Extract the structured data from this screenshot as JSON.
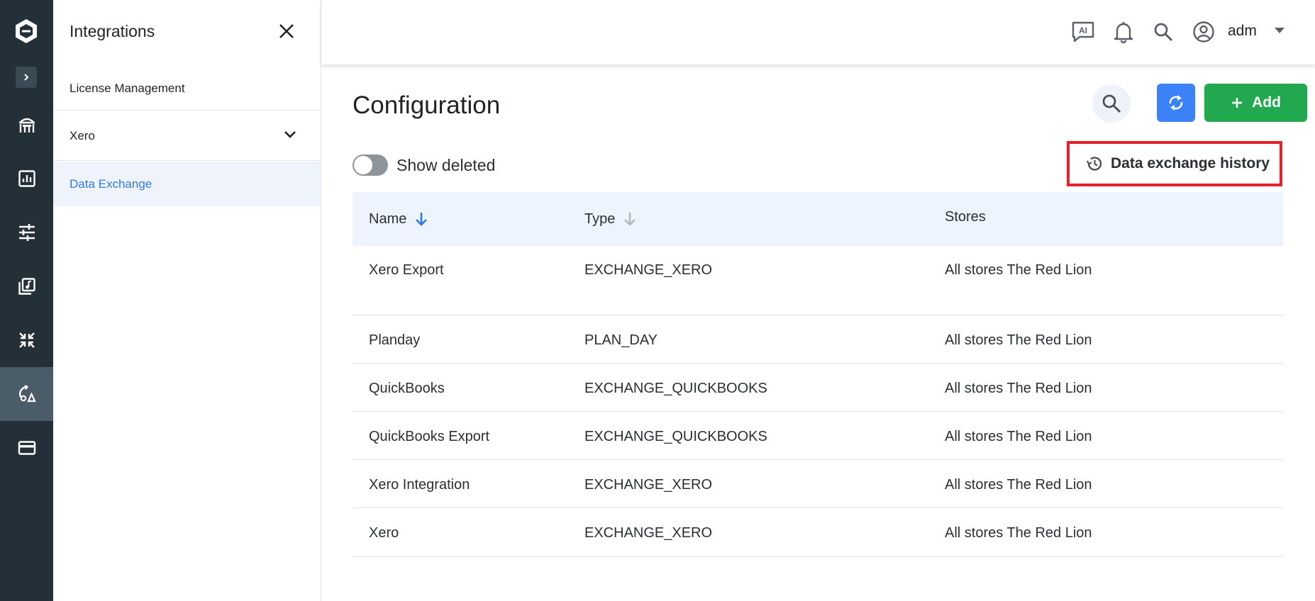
{
  "sidebar": {
    "title": "Integrations",
    "items": [
      {
        "label": "License Management"
      },
      {
        "label": "Xero"
      },
      {
        "label": "Data Exchange"
      }
    ]
  },
  "header": {
    "user": "adm"
  },
  "main": {
    "title": "Configuration",
    "add_label": "Add",
    "show_deleted_label": "Show deleted",
    "show_deleted": false,
    "history_label": "Data exchange history",
    "table": {
      "columns": [
        "Name",
        "Type",
        "Stores"
      ],
      "rows": [
        {
          "name": "Xero Export",
          "type": "EXCHANGE_XERO",
          "stores": "All stores The Red Lion"
        },
        {
          "name": "Planday",
          "type": "PLAN_DAY",
          "stores": "All stores The Red Lion"
        },
        {
          "name": "QuickBooks",
          "type": "EXCHANGE_QUICKBOOKS",
          "stores": "All stores The Red Lion"
        },
        {
          "name": "QuickBooks Export",
          "type": "EXCHANGE_QUICKBOOKS",
          "stores": "All stores The Red Lion"
        },
        {
          "name": "Xero Integration",
          "type": "EXCHANGE_XERO",
          "stores": "All stores The Red Lion"
        },
        {
          "name": "Xero",
          "type": "EXCHANGE_XERO",
          "stores": "All stores The Red Lion"
        }
      ]
    }
  },
  "colors": {
    "rail": "#243038",
    "accent": "#3b82f6",
    "add": "#22a94f",
    "highlight": "#e5202a",
    "active_item_bg": "#eef3fc",
    "active_item_text": "#2f7be4"
  },
  "icons": [
    "logo-icon",
    "chevron-right-icon",
    "dining-icon",
    "chart-icon",
    "sliders-icon",
    "music-library-icon",
    "collapse-arrows-icon",
    "integrations-icon",
    "card-icon",
    "close-icon",
    "chevron-down-icon",
    "ai-chat-icon",
    "bell-icon",
    "search-icon",
    "account-circle-icon",
    "caret-down-icon",
    "sync-icon",
    "plus-icon",
    "history-icon",
    "sort-arrow-down-icon"
  ]
}
